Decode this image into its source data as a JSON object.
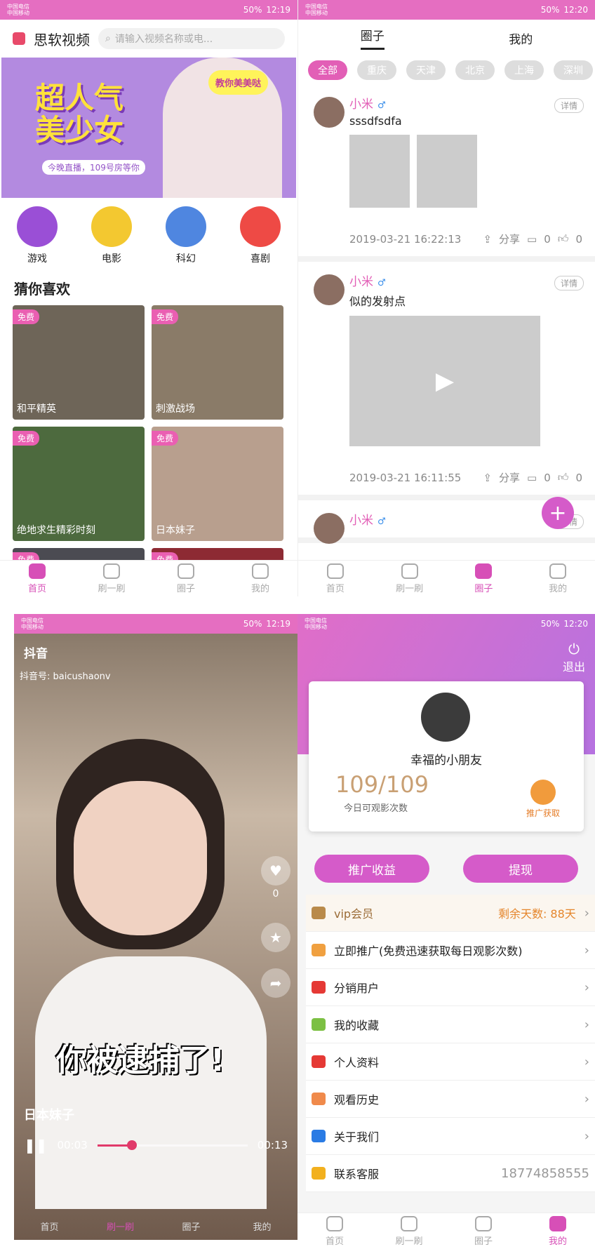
{
  "status": {
    "carrier1": "中国电信",
    "carrier2": "中国移动",
    "battery": "50%",
    "time1": "12:19",
    "time2": "12:20"
  },
  "home": {
    "app_title": "思软视频",
    "search_placeholder": "请输入视频名称或电...",
    "banner": {
      "title": "超人气美少女",
      "sub": "今晚直播，109号房等你",
      "bubble": "教你美美哒"
    },
    "categories": [
      {
        "label": "游戏",
        "color": "#9a4fd6"
      },
      {
        "label": "电影",
        "color": "#f3c830"
      },
      {
        "label": "科幻",
        "color": "#4f86e0"
      },
      {
        "label": "喜剧",
        "color": "#ee4a45"
      }
    ],
    "section": "猜你喜欢",
    "free": "免费",
    "cards": [
      {
        "cap": "和平精英",
        "color": "#6e6558"
      },
      {
        "cap": "刺激战场",
        "color": "#8a7b68"
      },
      {
        "cap": "绝地求生精彩时刻",
        "color": "#4d6a3e"
      },
      {
        "cap": "日本妹子",
        "color": "#b89f8e"
      },
      {
        "cap": "",
        "color": "#4b4b52"
      },
      {
        "cap": "",
        "color": "#8d2a33"
      }
    ]
  },
  "tabs": [
    "首页",
    "刷一刷",
    "圈子",
    "我的"
  ],
  "circle": {
    "tab_circle": "圈子",
    "tab_mine": "我的",
    "chips": [
      "全部",
      "重庆",
      "天津",
      "北京",
      "上海",
      "深圳"
    ],
    "detail": "详情",
    "share": "分享",
    "posts": [
      {
        "user": "小米",
        "text": "sssdfsdfa",
        "time": "2019-03-21 16:22:13",
        "comments": "0",
        "likes": "0"
      },
      {
        "user": "小米",
        "text": "似的发射点",
        "time": "2019-03-21 16:11:55",
        "comments": "0",
        "likes": "0"
      },
      {
        "user": "小米"
      }
    ]
  },
  "player": {
    "brand": "抖音",
    "id": "抖音号: baicushaonv",
    "subtitle": "你被逮捕了!",
    "title": "日本妹子",
    "current": "00:03",
    "total": "00:13",
    "progress": 0.23,
    "likes": "0"
  },
  "mine": {
    "logout": "退出",
    "username": "幸福的小朋友",
    "count": "109/109",
    "count_label": "今日可观影次数",
    "promo": "推广获取",
    "btn_income": "推广收益",
    "btn_withdraw": "提现",
    "vip_label": "vip会员",
    "vip_days": "剩余天数: 88天",
    "menu": [
      {
        "label": "立即推广(免费迅速获取每日观影次数)",
        "color": "#f0a040",
        "right": "›"
      },
      {
        "label": "分销用户",
        "color": "#e53935",
        "right": "›"
      },
      {
        "label": "我的收藏",
        "color": "#7cc043",
        "right": "›"
      },
      {
        "label": "个人资料",
        "color": "#e53935",
        "right": "›"
      },
      {
        "label": "观看历史",
        "color": "#f08a4b",
        "right": "›"
      },
      {
        "label": "关于我们",
        "color": "#2a7be4",
        "right": "›"
      },
      {
        "label": "联系客服",
        "color": "#f2b01e",
        "right": "18774858555"
      }
    ]
  }
}
